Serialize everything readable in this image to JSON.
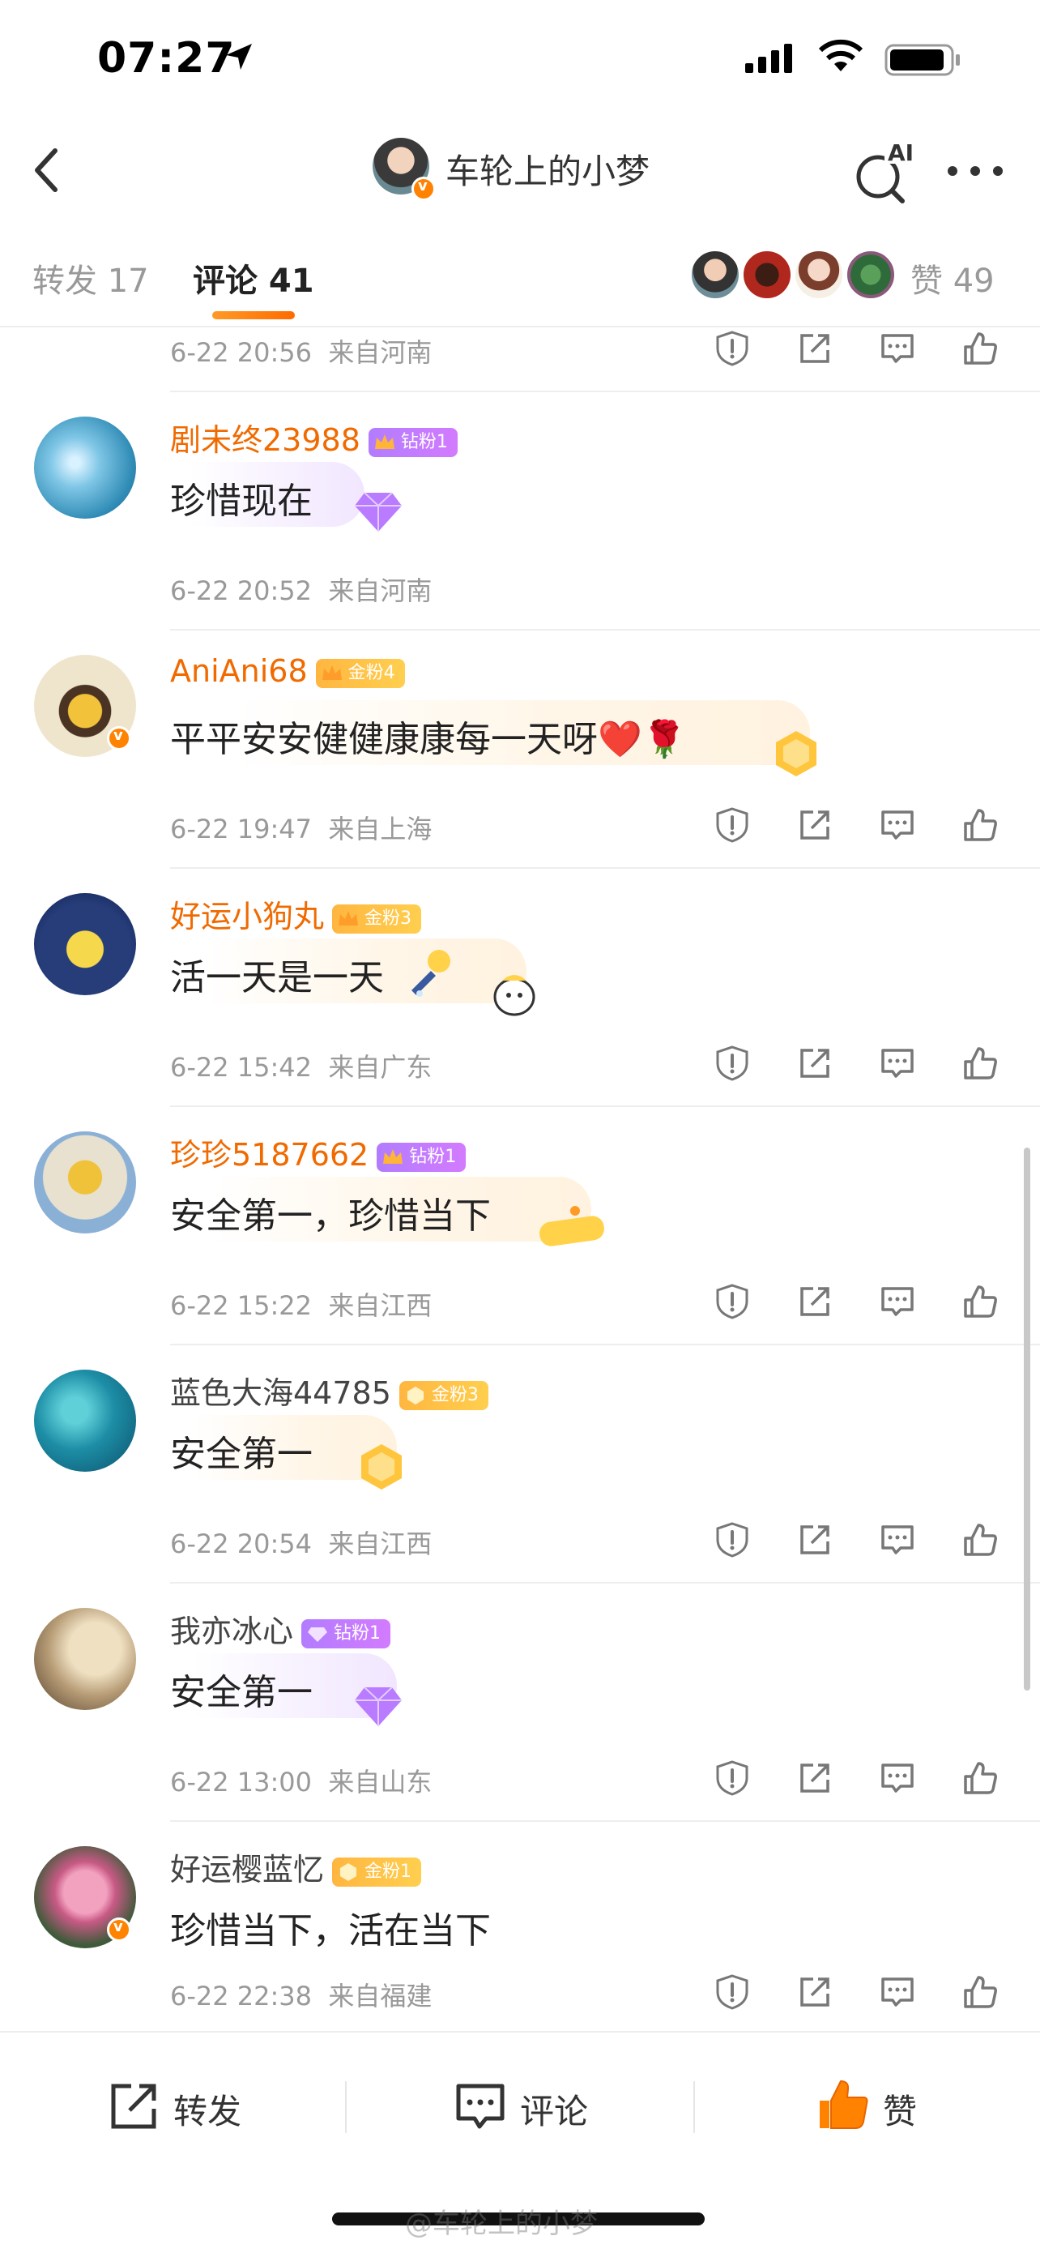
{
  "status_bar": {
    "time": "07:27"
  },
  "header": {
    "title": "车轮上的小梦",
    "ai_label": "AI"
  },
  "tabs": {
    "repost": "转发 17",
    "comment": "评论 41",
    "like": "赞 49"
  },
  "top_meta": {
    "time": "6-22 20:56",
    "location": "来自河南"
  },
  "comments": [
    {
      "user": "剧未终23988",
      "badge": "钻粉1",
      "text": "珍惜现在",
      "time": "6-22 20:52",
      "location": "来自河南"
    },
    {
      "user": "AniAni68",
      "badge": "金粉4",
      "text": "平平安安健健康康每一天呀❤️🌹",
      "time": "6-22 19:47",
      "location": "来自上海"
    },
    {
      "user": "好运小狗丸",
      "badge": "金粉3",
      "text": "活一天是一天",
      "time": "6-22 15:42",
      "location": "来自广东"
    },
    {
      "user": "珍珍5187662",
      "badge": "钻粉1",
      "text": "安全第一，珍惜当下",
      "time": "6-22 15:22",
      "location": "来自江西"
    },
    {
      "user": "蓝色大海44785",
      "badge": "金粉3",
      "text": "安全第一",
      "time": "6-22 20:54",
      "location": "来自江西"
    },
    {
      "user": "我亦冰心",
      "badge": "钻粉1",
      "text": "安全第一",
      "time": "6-22 13:00",
      "location": "来自山东"
    },
    {
      "user": "好运樱蓝忆",
      "badge": "金粉1",
      "text": "珍惜当下，活在当下",
      "time": "6-22 22:38",
      "location": "来自福建"
    }
  ],
  "bottom_bar": {
    "repost": "转发",
    "comment": "评论",
    "like": "赞"
  },
  "watermark": "@车轮上的小梦",
  "colors": {
    "accent": "#ff8200",
    "username": "#f06a00",
    "diamond_badge": "#c27dff",
    "gold_badge": "#ffc24a"
  }
}
